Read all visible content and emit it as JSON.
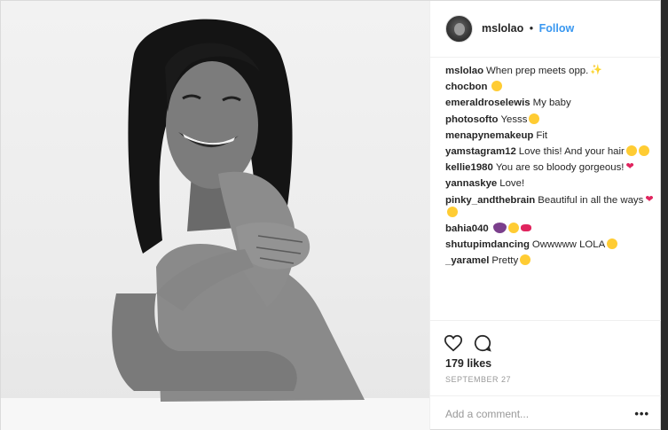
{
  "post": {
    "username": "mslolao",
    "dot": "•",
    "follow_label": "Follow",
    "likes": "179 likes",
    "date": "SEPTEMBER 27",
    "add_comment_placeholder": "Add a comment...",
    "more_label": "•••"
  },
  "comments": [
    {
      "user": "mslolao",
      "text": "When prep meets opp.",
      "emoji": [
        "spark"
      ]
    },
    {
      "user": "chocbon",
      "text": "",
      "emoji": [
        "smile"
      ]
    },
    {
      "user": "emeraldroselewis",
      "text": "My baby",
      "emoji": []
    },
    {
      "user": "photosofto",
      "text": "Yesss",
      "emoji": [
        "smile"
      ]
    },
    {
      "user": "menapynemakeup",
      "text": "Fit",
      "emoji": []
    },
    {
      "user": "yamstagram12",
      "text": "Love this! And your hair",
      "emoji": [
        "smile",
        "smile"
      ]
    },
    {
      "user": "kellie1980",
      "text": "You are so bloody gorgeous!",
      "emoji": [
        "heart"
      ]
    },
    {
      "user": "yannaskye",
      "text": "Love!",
      "emoji": []
    },
    {
      "user": "pinky_andthebrain",
      "text": "Beautiful in all the ways",
      "emoji": [
        "heart",
        "smile"
      ]
    },
    {
      "user": "bahia040",
      "text": "",
      "emoji": [
        "egg",
        "smile",
        "lips"
      ]
    },
    {
      "user": "shutupimdancing",
      "text": "Owwwww LOLA",
      "emoji": [
        "smile"
      ]
    },
    {
      "user": "_yaramel",
      "text": "Pretty",
      "emoji": [
        "smile"
      ]
    }
  ],
  "icons": {
    "like": "heart-outline-icon",
    "comment": "speech-bubble-icon",
    "avatar": "profile-avatar"
  },
  "colors": {
    "link_blue": "#3897f0",
    "text": "#262626",
    "muted": "#999999",
    "border": "#efefef"
  }
}
